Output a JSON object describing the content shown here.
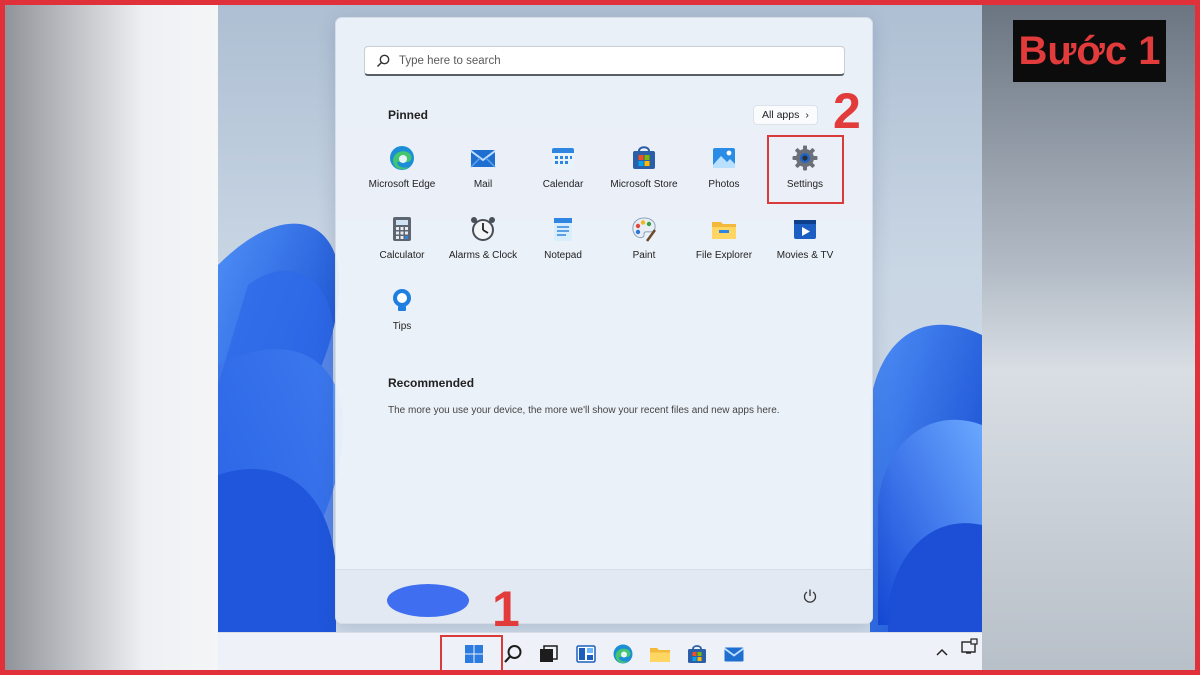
{
  "step_badge": "Bước 1",
  "annotations": {
    "marker_1": "1",
    "marker_2": "2"
  },
  "search": {
    "placeholder": "Type here to search"
  },
  "pinned": {
    "title": "Pinned",
    "all_apps_label": "All apps",
    "all_apps_chevron": "›",
    "apps": [
      {
        "label": "Microsoft Edge",
        "icon": "edge-icon"
      },
      {
        "label": "Mail",
        "icon": "mail-icon"
      },
      {
        "label": "Calendar",
        "icon": "calendar-icon"
      },
      {
        "label": "Microsoft Store",
        "icon": "store-icon"
      },
      {
        "label": "Photos",
        "icon": "photos-icon"
      },
      {
        "label": "Settings",
        "icon": "gear-icon"
      },
      {
        "label": "Calculator",
        "icon": "calculator-icon"
      },
      {
        "label": "Alarms & Clock",
        "icon": "clock-icon"
      },
      {
        "label": "Notepad",
        "icon": "notepad-icon"
      },
      {
        "label": "Paint",
        "icon": "paint-icon"
      },
      {
        "label": "File Explorer",
        "icon": "folder-icon"
      },
      {
        "label": "Movies & TV",
        "icon": "movies-icon"
      },
      {
        "label": "Tips",
        "icon": "lightbulb-icon"
      }
    ]
  },
  "recommended": {
    "title": "Recommended",
    "text": "The more you use your device, the more we'll show your recent files and new apps here."
  },
  "taskbar": {
    "items": [
      "windows-start-icon",
      "search-icon",
      "task-view-icon",
      "widgets-icon",
      "edge-icon",
      "folder-icon",
      "store-icon",
      "mail-icon"
    ],
    "tray": [
      "chevron-up-icon",
      "notification-icon"
    ]
  },
  "colors": {
    "accent": "#3f6ef0",
    "highlight_red": "#d93b3b",
    "frame_red": "#e0303a"
  }
}
